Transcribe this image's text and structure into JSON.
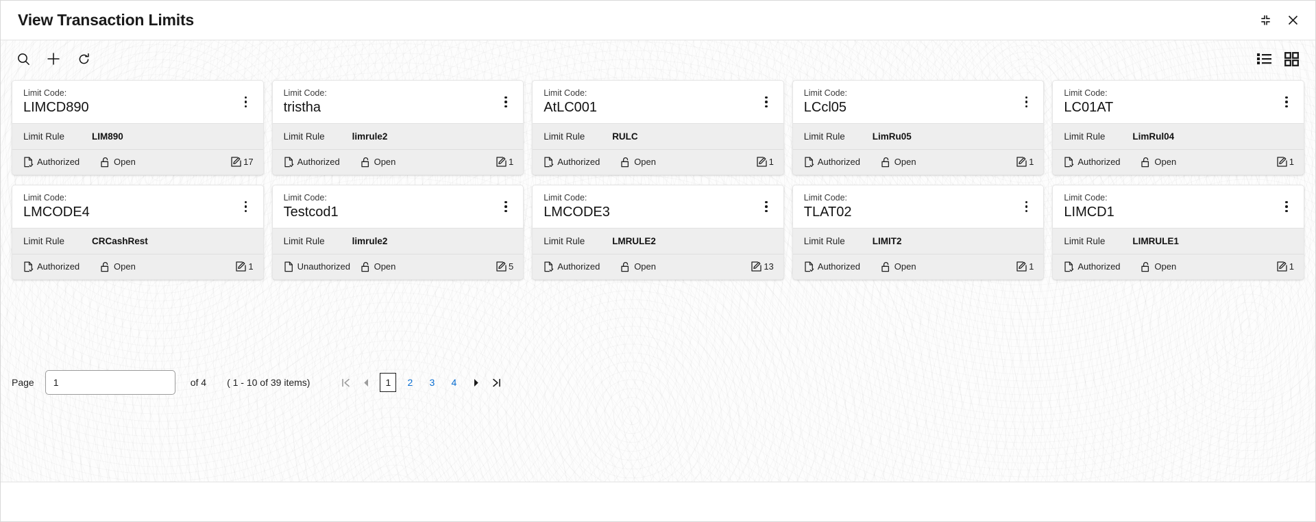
{
  "window": {
    "title": "View Transaction Limits",
    "controls": [
      {
        "name": "collapse-button",
        "icon": "collapse-icon"
      },
      {
        "name": "close-button",
        "icon": "close-icon"
      }
    ]
  },
  "toolbar": {
    "actions": [
      {
        "name": "search-button",
        "icon": "search-icon",
        "tooltip": "Search"
      },
      {
        "name": "add-button",
        "icon": "plus-icon",
        "tooltip": "Add"
      },
      {
        "name": "refresh-button",
        "icon": "refresh-icon",
        "tooltip": "Refresh"
      }
    ],
    "view_modes": [
      {
        "name": "list-view-button",
        "icon": "list-view-icon",
        "active": false
      },
      {
        "name": "grid-view-button",
        "icon": "grid-view-icon",
        "active": true
      }
    ]
  },
  "card_labels": {
    "code_label": "Limit Code:",
    "rule_label": "Limit Rule"
  },
  "cards": [
    {
      "code": "LIMCD890",
      "rule": "LIM890",
      "auth_status": "Authorized",
      "auth_icon": "document-check-icon",
      "record_state": "Open",
      "state_icon": "unlock-icon",
      "count": "17"
    },
    {
      "code": "tristha",
      "rule": "limrule2",
      "auth_status": "Authorized",
      "auth_icon": "document-check-icon",
      "record_state": "Open",
      "state_icon": "unlock-icon",
      "count": "1"
    },
    {
      "code": "AtLC001",
      "rule": "RULC",
      "auth_status": "Authorized",
      "auth_icon": "document-check-icon",
      "record_state": "Open",
      "state_icon": "unlock-icon",
      "count": "1"
    },
    {
      "code": "LCcl05",
      "rule": "LimRu05",
      "auth_status": "Authorized",
      "auth_icon": "document-check-icon",
      "record_state": "Open",
      "state_icon": "unlock-icon",
      "count": "1"
    },
    {
      "code": "LC01AT",
      "rule": "LimRul04",
      "auth_status": "Authorized",
      "auth_icon": "document-check-icon",
      "record_state": "Open",
      "state_icon": "unlock-icon",
      "count": "1"
    },
    {
      "code": "LMCODE4",
      "rule": "CRCashRest",
      "auth_status": "Authorized",
      "auth_icon": "document-check-icon",
      "record_state": "Open",
      "state_icon": "unlock-icon",
      "count": "1"
    },
    {
      "code": "Testcod1",
      "rule": "limrule2",
      "auth_status": "Unauthorized",
      "auth_icon": "document-icon",
      "record_state": "Open",
      "state_icon": "unlock-icon",
      "count": "5"
    },
    {
      "code": "LMCODE3",
      "rule": "LMRULE2",
      "auth_status": "Authorized",
      "auth_icon": "document-check-icon",
      "record_state": "Open",
      "state_icon": "unlock-icon",
      "count": "13"
    },
    {
      "code": "TLAT02",
      "rule": "LIMIT2",
      "auth_status": "Authorized",
      "auth_icon": "document-check-icon",
      "record_state": "Open",
      "state_icon": "unlock-icon",
      "count": "1"
    },
    {
      "code": "LIMCD1",
      "rule": "LIMRULE1",
      "auth_status": "Authorized",
      "auth_icon": "document-check-icon",
      "record_state": "Open",
      "state_icon": "unlock-icon",
      "count": "1"
    }
  ],
  "pagination": {
    "page_label": "Page",
    "page_value": "1",
    "page_placeholder": "",
    "of_text": "of 4",
    "items_text": "( 1 - 10 of 39 items)",
    "total_pages": 4,
    "current_page": 1,
    "page_numbers": [
      "1",
      "2",
      "3",
      "4"
    ],
    "first_icon": "first-page-icon",
    "prev_icon": "prev-page-icon",
    "next_icon": "next-page-icon",
    "last_icon": "last-page-icon",
    "link_color": "#0a6ed1"
  },
  "colors": {
    "accent": "#0a6ed1",
    "card_bg": "#ffffff",
    "card_alt_bg": "#eeeeee",
    "text": "#1a1a1a"
  }
}
